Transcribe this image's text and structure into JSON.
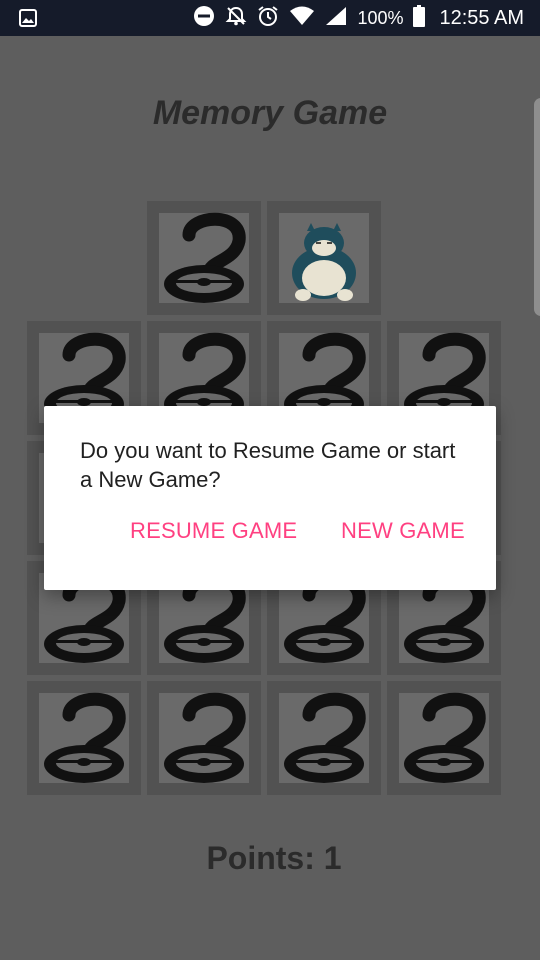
{
  "status_bar": {
    "battery": "100%",
    "time": "12:55 AM"
  },
  "app": {
    "title": "Memory Game",
    "points_label": "Points: 1"
  },
  "cards": [
    {
      "row": 0,
      "col": 1,
      "face": "hidden"
    },
    {
      "row": 0,
      "col": 2,
      "face": "snorlax"
    },
    {
      "row": 1,
      "col": 0,
      "face": "hidden"
    },
    {
      "row": 1,
      "col": 1,
      "face": "hidden"
    },
    {
      "row": 1,
      "col": 2,
      "face": "hidden"
    },
    {
      "row": 1,
      "col": 3,
      "face": "hidden"
    },
    {
      "row": 2,
      "col": 0,
      "face": "hidden"
    },
    {
      "row": 2,
      "col": 1,
      "face": "hidden"
    },
    {
      "row": 2,
      "col": 2,
      "face": "hidden"
    },
    {
      "row": 2,
      "col": 3,
      "face": "hidden"
    },
    {
      "row": 3,
      "col": 0,
      "face": "hidden"
    },
    {
      "row": 3,
      "col": 1,
      "face": "hidden"
    },
    {
      "row": 3,
      "col": 2,
      "face": "hidden"
    },
    {
      "row": 3,
      "col": 3,
      "face": "hidden"
    },
    {
      "row": 4,
      "col": 0,
      "face": "hidden"
    },
    {
      "row": 4,
      "col": 1,
      "face": "hidden"
    },
    {
      "row": 4,
      "col": 2,
      "face": "hidden"
    },
    {
      "row": 4,
      "col": 3,
      "face": "hidden"
    }
  ],
  "dialog": {
    "message": "Do you want to Resume Game or start a New Game?",
    "resume_label": "RESUME GAME",
    "new_label": "NEW GAME"
  },
  "colors": {
    "accent": "#ff4081",
    "status_bar": "#151b2a",
    "scrim": "#5e5e5e"
  }
}
